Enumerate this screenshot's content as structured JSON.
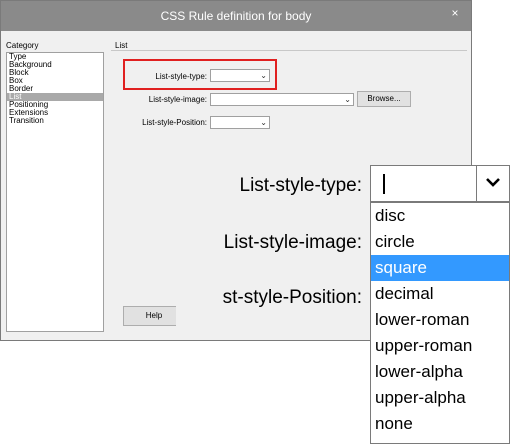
{
  "dialog": {
    "title": "CSS Rule definition for body",
    "close_glyph": "×",
    "category_label": "Category",
    "section_title": "List",
    "categories": [
      "Type",
      "Background",
      "Block",
      "Box",
      "Border",
      "List",
      "Positioning",
      "Extensions",
      "Transition"
    ],
    "selected_category": "List",
    "fields": {
      "list_style_type": "List-style-type:",
      "list_style_image": "List-style-image:",
      "list_style_position": "List-style-Position:"
    },
    "browse_label": "Browse...",
    "help_label": "Help"
  },
  "zoom": {
    "list_style_type": "List-style-type:",
    "list_style_image": "List-style-image:",
    "list_style_position": "st-style-Position:",
    "options": [
      "disc",
      "circle",
      "square",
      "decimal",
      "lower-roman",
      "upper-roman",
      "lower-alpha",
      "upper-alpha",
      "none"
    ],
    "highlighted": "square"
  },
  "colors": {
    "titlebar": "#8a8a8a",
    "highlight_box": "#e02020",
    "selected_option": "#3399ff"
  },
  "icons": {
    "dropdown": "chevron-down-icon",
    "close": "close-icon"
  }
}
